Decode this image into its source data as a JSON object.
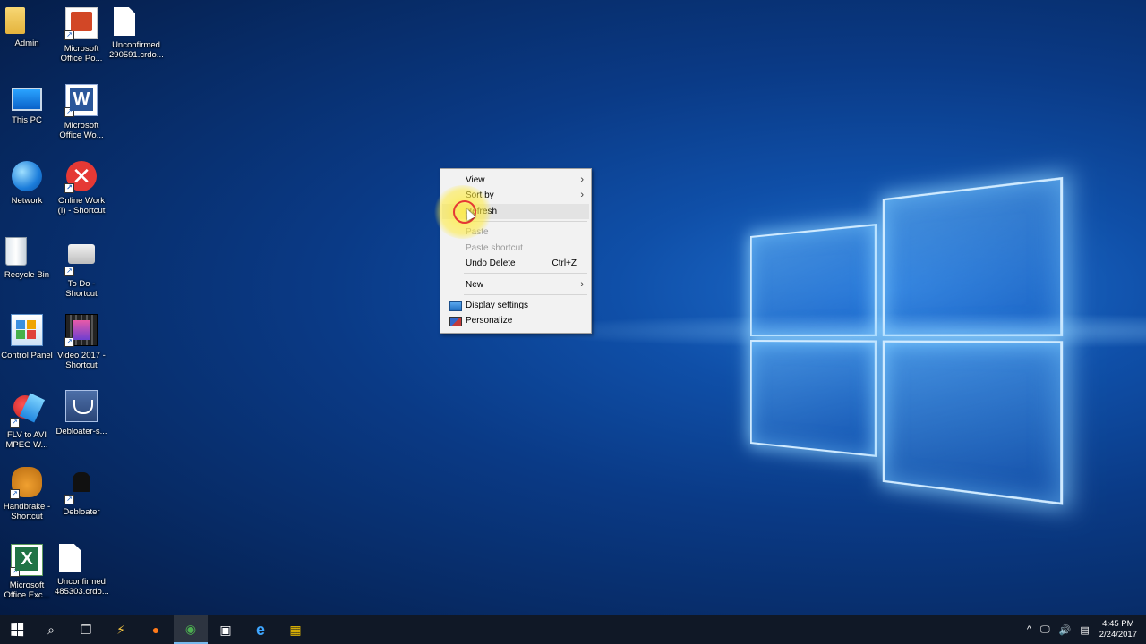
{
  "desktop_icons": [
    {
      "label": "Admin",
      "icon": "user-folder-icon"
    },
    {
      "label": "Microsoft\nOffice Po...",
      "icon": "powerpoint-icon"
    },
    {
      "label": "Unconfirmed\n290591.crdo...",
      "icon": "file-icon"
    },
    {
      "label": "This PC",
      "icon": "computer-icon"
    },
    {
      "label": "Microsoft\nOffice Wo...",
      "icon": "word-icon"
    },
    {
      "label": "Network",
      "icon": "network-icon"
    },
    {
      "label": "Online Work\n(I) - Shortcut",
      "icon": "error-x-icon"
    },
    {
      "label": "Recycle Bin",
      "icon": "recycle-bin-icon"
    },
    {
      "label": "To Do -\nShortcut",
      "icon": "drive-icon"
    },
    {
      "label": "Control Panel",
      "icon": "control-panel-icon"
    },
    {
      "label": "Video 2017 -\nShortcut",
      "icon": "video-folder-icon"
    },
    {
      "label": "FLV to AVI\nMPEG W...",
      "icon": "converter-icon"
    },
    {
      "label": "Debloater-s...",
      "icon": "debloater-icon"
    },
    {
      "label": "Handbrake -\nShortcut",
      "icon": "handbrake-icon"
    },
    {
      "label": "Debloater",
      "icon": "hat-icon"
    },
    {
      "label": "Microsoft\nOffice Exc...",
      "icon": "excel-icon"
    },
    {
      "label": "Unconfirmed\n485303.crdo...",
      "icon": "file-icon"
    }
  ],
  "context_menu": {
    "items": [
      {
        "label": "View",
        "has_submenu": true,
        "disabled": false
      },
      {
        "label": "Sort by",
        "has_submenu": true,
        "disabled": false
      },
      {
        "label": "Refresh",
        "has_submenu": false,
        "disabled": false,
        "hover": true
      },
      {
        "label": "Paste",
        "disabled": true
      },
      {
        "label": "Paste shortcut",
        "disabled": true
      },
      {
        "label": "Undo Delete",
        "shortcut": "Ctrl+Z",
        "disabled": false
      },
      {
        "label": "New",
        "has_submenu": true,
        "disabled": false
      },
      {
        "label": "Display settings",
        "icon": "display-icon",
        "disabled": false
      },
      {
        "label": "Personalize",
        "icon": "personalize-icon",
        "disabled": false
      }
    ],
    "arrow_glyph": "›"
  },
  "taskbar": {
    "start_icon": "windows-start-icon",
    "search_icon": "search-icon",
    "task_view_icon": "task-view-icon",
    "pinned": [
      {
        "name": "winamp-icon",
        "glyph": "⚡"
      },
      {
        "name": "firefox-icon",
        "glyph": "●"
      },
      {
        "name": "chrome-icon",
        "glyph": "◉"
      },
      {
        "name": "store-icon",
        "glyph": "▣"
      },
      {
        "name": "edge-icon",
        "glyph": "e"
      },
      {
        "name": "app-grid-icon",
        "glyph": "▦"
      }
    ],
    "tray": {
      "chevron": "^",
      "network_glyph": "🖵",
      "volume_glyph": "🔊",
      "notification_glyph": "▤",
      "time": "4:45 PM",
      "date": "2/24/2017"
    }
  }
}
